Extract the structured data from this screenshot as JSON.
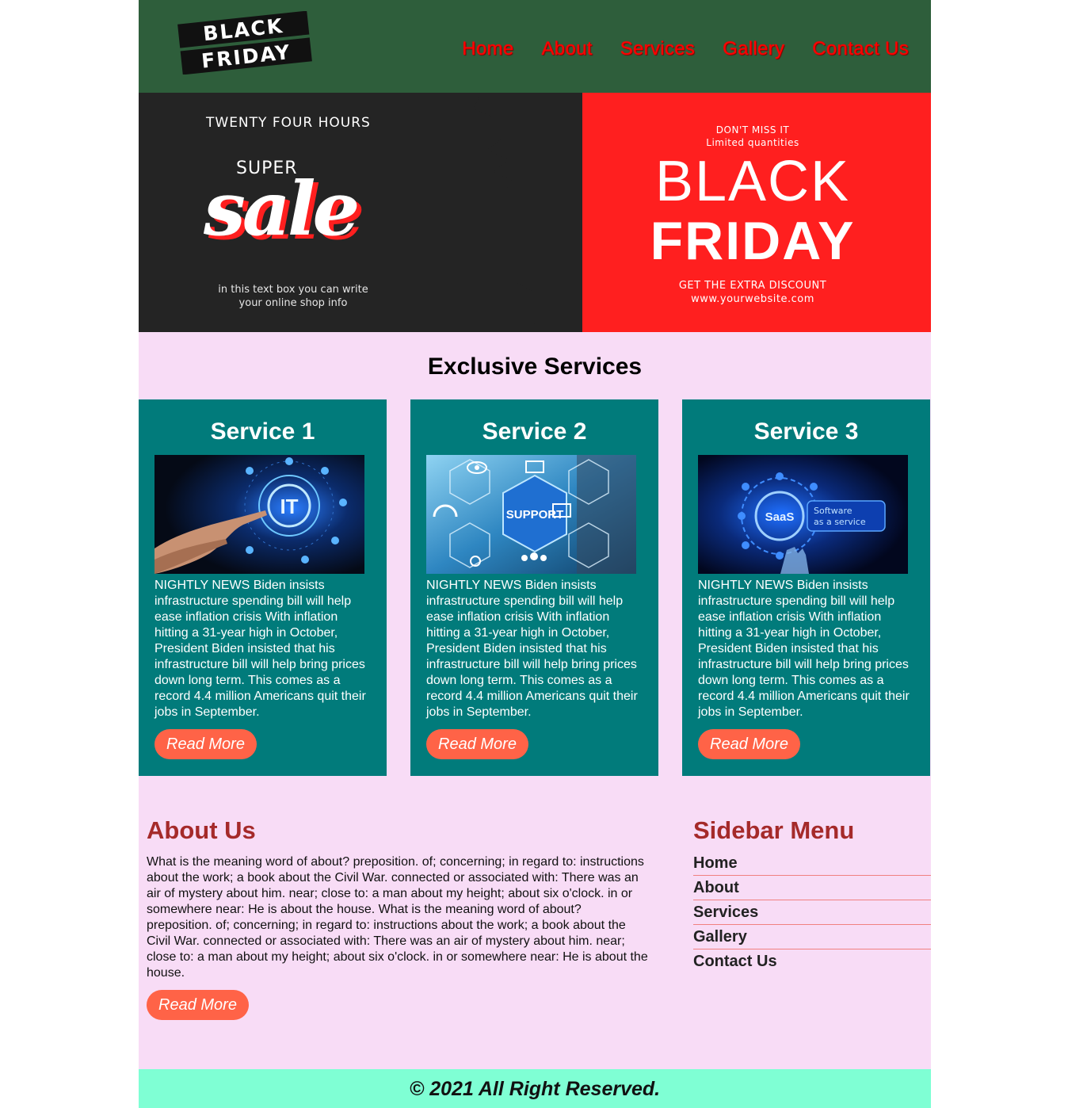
{
  "header": {
    "logo_line1": "BLACK",
    "logo_line2": "FRIDAY",
    "nav": [
      "Home",
      "About",
      "Services",
      "Gallery",
      "Contact Us"
    ]
  },
  "banner": {
    "left_top": "TWENTY FOUR HOURS",
    "super": "SUPER",
    "sale": "sale",
    "info_line1": "in this text box you can write",
    "info_line2": "your online shop info",
    "dont_miss": "DON'T MISS IT",
    "limited": "Limited  quantities",
    "black": "BLACK",
    "friday": "FRIDAY",
    "extra": "GET THE EXTRA DISCOUNT",
    "website": "www.yourwebsite.com"
  },
  "services": {
    "title": "Exclusive Services",
    "cards": [
      {
        "title": "Service 1",
        "image_icon": "it-technology-image",
        "text": "NIGHTLY NEWS Biden insists infrastructure spending bill will help ease inflation crisis With inflation hitting a 31-year high in October, President Biden insisted that his infrastructure bill will help bring prices down long term. This comes as a record 4.4 million Americans quit their jobs in September.",
        "button": "Read More"
      },
      {
        "title": "Service 2",
        "image_icon": "support-image",
        "image_label": "SUPPORT",
        "text": "NIGHTLY NEWS Biden insists infrastructure spending bill will help ease inflation crisis With inflation hitting a 31-year high in October, President Biden insisted that his infrastructure bill will help bring prices down long term. This comes as a record 4.4 million Americans quit their jobs in September.",
        "button": "Read More"
      },
      {
        "title": "Service 3",
        "image_icon": "saas-image",
        "image_label_main": "SaaS",
        "image_label_side1": "Software",
        "image_label_side2": "as a service",
        "text": "NIGHTLY NEWS Biden insists infrastructure spending bill will help ease inflation crisis With inflation hitting a 31-year high in October, President Biden insisted that his infrastructure bill will help bring prices down long term. This comes as a record 4.4 million Americans quit their jobs in September.",
        "button": "Read More"
      }
    ]
  },
  "about": {
    "title": "About Us",
    "text": "What is the meaning word of about? preposition. of; concerning; in regard to: instructions about the work; a book about the Civil War. connected or associated with: There was an air of mystery about him. near; close to: a man about my height; about six o'clock. in or somewhere near: He is about the house. What is the meaning word of about? preposition. of; concerning; in regard to: instructions about the work; a book about the Civil War. connected or associated with: There was an air of mystery about him. near; close to: a man about my height; about six o'clock. in or somewhere near: He is about the house.",
    "button": "Read More"
  },
  "sidebar": {
    "title": "Sidebar Menu",
    "items": [
      "Home",
      "About",
      "Services",
      "Gallery",
      "Contact Us"
    ]
  },
  "footer": {
    "text": "© 2021 All Right Reserved."
  },
  "colors": {
    "header_bg": "#2e5e3b",
    "nav_link": "#ff0000",
    "page_bg": "#f8dcf6",
    "card_bg": "#017b7b",
    "button_bg": "#ff6347",
    "heading_brown": "#a52a2a",
    "footer_bg": "#7fffd4"
  }
}
